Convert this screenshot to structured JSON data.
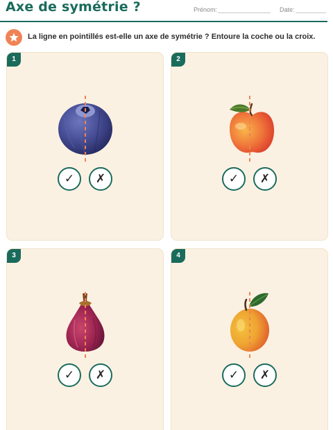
{
  "header": {
    "title": "Axe de symétrie ?",
    "prenom_label": "Prénom:",
    "date_label": "Date:"
  },
  "instruction": {
    "icon": "star-icon",
    "text": "La ligne en pointillés est-elle un axe de symétrie ? Entoure la coche ou la croix."
  },
  "colors": {
    "accent": "#1a6b5c",
    "badge_orange": "#ef8356",
    "card_bg": "#fbf1e2",
    "dashed_line": "#ef8356"
  },
  "cards": [
    {
      "number": "1",
      "fruit": "blueberry",
      "check": "✓",
      "cross": "✗"
    },
    {
      "number": "2",
      "fruit": "apple",
      "check": "✓",
      "cross": "✗"
    },
    {
      "number": "3",
      "fruit": "fig",
      "check": "✓",
      "cross": "✗"
    },
    {
      "number": "4",
      "fruit": "apricot",
      "check": "✓",
      "cross": "✗"
    }
  ]
}
